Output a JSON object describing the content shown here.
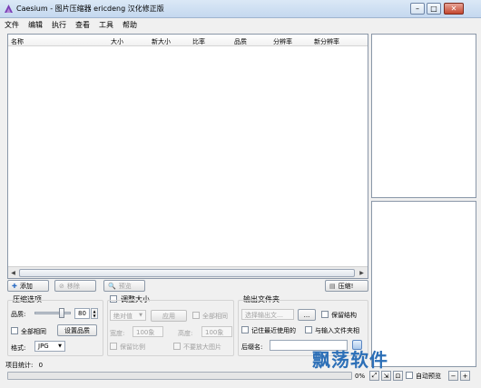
{
  "window": {
    "title": "Caesium - 图片压缩器  ericdeng 汉化修正版",
    "controls": {
      "minimize": "–",
      "maximize": "□",
      "close": "✕"
    }
  },
  "menu": [
    "文件",
    "编辑",
    "执行",
    "查看",
    "工具",
    "帮助"
  ],
  "filelist": {
    "columns": [
      "名称",
      "大小",
      "新大小",
      "比率",
      "品质",
      "分辨率",
      "新分辨率"
    ]
  },
  "toolbar": {
    "add": "添加",
    "remove": "移除",
    "preview": "预览",
    "compress": "压缩!"
  },
  "compression": {
    "title": "压缩选项",
    "quality_label": "品质:",
    "quality_value": "80",
    "same_all": "全部相同",
    "set_quality": "设置品质",
    "format_label": "格式:",
    "format_value": "JPG"
  },
  "resize": {
    "title": "调整大小",
    "mode": "绝对值",
    "apply": "应用",
    "same_all": "全部相同",
    "width_label": "宽度:",
    "width_value": "100象",
    "height_label": "高度:",
    "height_value": "100象",
    "keep_ratio": "保留比例",
    "no_enlarge": "不要放大图片"
  },
  "output": {
    "title": "输出文件夹",
    "placeholder": "选择输出文…",
    "browse": "...",
    "keep_structure": "保留结构",
    "remember_last": "记住最近使用的",
    "same_as_input": "与输入文件夹相",
    "suffix_label": "后缀名:"
  },
  "status": {
    "item_count_label": "项目统计:",
    "item_count": "0",
    "progress_pct": "0%",
    "auto_preview": "自动预览"
  },
  "watermark": "飘荡软件",
  "colors": {
    "watermark": "#2c6fb7",
    "titlebar": "#c4d8ef"
  }
}
